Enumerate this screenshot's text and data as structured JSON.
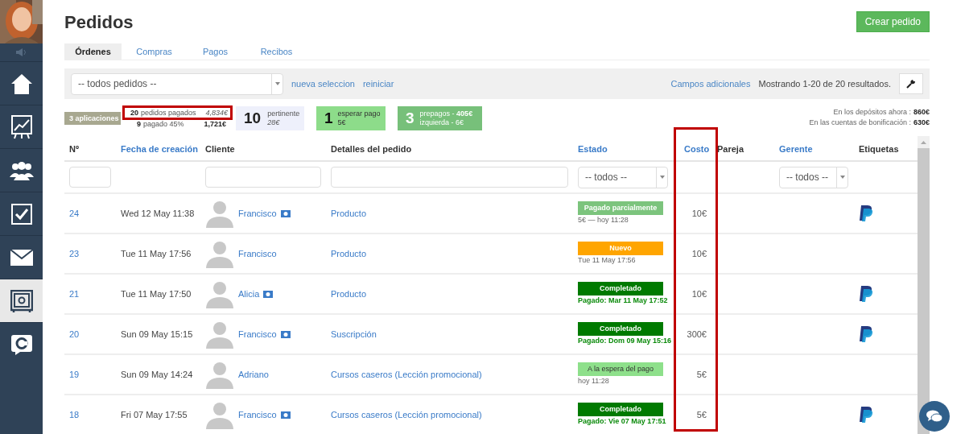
{
  "sidebar": {
    "items": [
      {
        "selected": false
      },
      {
        "selected": false
      },
      {
        "selected": false
      },
      {
        "selected": false
      },
      {
        "selected": false
      },
      {
        "selected": true
      },
      {
        "selected": false
      }
    ]
  },
  "page": {
    "title": "Pedidos",
    "create_button": "Crear pedido"
  },
  "tabs": [
    {
      "label": "Órdenes",
      "selected": true
    },
    {
      "label": "Compras",
      "selected": false
    },
    {
      "label": "Pagos",
      "selected": false
    },
    {
      "label": "Recibos",
      "selected": false
    }
  ],
  "filter_bar": {
    "select_value": "-- todos pedidos --",
    "new_selection": "nueva seleccion",
    "reset": "reiniciar",
    "extra_fields": "Campos adicionales",
    "showing": "Mostrando 1-20 de 20 resultados."
  },
  "stats": {
    "applications": "3 aplicaciones",
    "paid": {
      "count": "20",
      "label": "pedidos pagados",
      "amount": "4,834€"
    },
    "paid_part": {
      "count": "9",
      "label": "pagado 45%",
      "amount": "1,721€"
    },
    "relevant": {
      "count": "10",
      "label": "pertinente",
      "amount": "28€"
    },
    "awaiting": {
      "count": "1",
      "label": "esperar pago",
      "amount": "5€"
    },
    "prepaid": {
      "count": "3",
      "line1": "prepagos - **405€**",
      "line2": "izquierda - 6€"
    }
  },
  "balances": [
    {
      "label": "En los depósitos ahora :",
      "value": "860€"
    },
    {
      "label": "En las cuentas de bonificación :",
      "value": "630€"
    }
  ],
  "table": {
    "columns": [
      {
        "label": "Nº",
        "sortable": false
      },
      {
        "label": "Fecha de creación",
        "sortable": true
      },
      {
        "label": "Cliente",
        "sortable": false
      },
      {
        "label": "Detalles del pedido",
        "sortable": false
      },
      {
        "label": "Estado",
        "sortable": true
      },
      {
        "label": "Costo",
        "sortable": true
      },
      {
        "label": "Pareja",
        "sortable": false
      },
      {
        "label": "Gerente",
        "sortable": true
      },
      {
        "label": "Etiquetas",
        "sortable": false
      }
    ],
    "filters": {
      "status": "-- todos --",
      "manager": "-- todos --"
    },
    "rows": [
      {
        "number": "24",
        "date": "Wed 12 May 11:38",
        "client": "Francisco",
        "client_badge": true,
        "details": "Producto",
        "status": {
          "kind": "partial",
          "label": "Pagado parcialmente",
          "note": "5€ — hoy 11:28"
        },
        "cost": "10€",
        "paypal": true
      },
      {
        "number": "23",
        "date": "Tue 11 May 17:56",
        "client": "Francisco",
        "client_badge": false,
        "details": "Producto",
        "status": {
          "kind": "new",
          "label": "Nuevo",
          "note": "Tue 11 May 17:56"
        },
        "cost": "10€",
        "paypal": false
      },
      {
        "number": "21",
        "date": "Tue 11 May 17:50",
        "client": "Alicia",
        "client_badge": true,
        "details": "Producto",
        "status": {
          "kind": "completed",
          "label": "Completado",
          "note": "Pagado: Mar 11 May 17:52"
        },
        "cost": "10€",
        "paypal": true
      },
      {
        "number": "20",
        "date": "Sun 09 May 15:15",
        "client": "Francisco",
        "client_badge": true,
        "details": "Suscripción",
        "status": {
          "kind": "completed",
          "label": "Completado",
          "note": "Pagado: Dom 09 May 15:16"
        },
        "cost": "300€",
        "paypal": true
      },
      {
        "number": "19",
        "date": "Sun 09 May 14:24",
        "client": "Adriano",
        "client_badge": false,
        "details": "Cursos caseros (Lección promocional)",
        "status": {
          "kind": "waiting",
          "label": "A la espera del pago",
          "note": "hoy 11:28"
        },
        "cost": "5€",
        "paypal": false
      },
      {
        "number": "18",
        "date": "Fri 07 May 17:55",
        "client": "Francisco",
        "client_badge": true,
        "details": "Cursos caseros (Lección promocional)",
        "status": {
          "kind": "completed",
          "label": "Completado",
          "note": "Pagado: Vie 07 May 17:51"
        },
        "cost": "5€",
        "paypal": true
      }
    ]
  }
}
